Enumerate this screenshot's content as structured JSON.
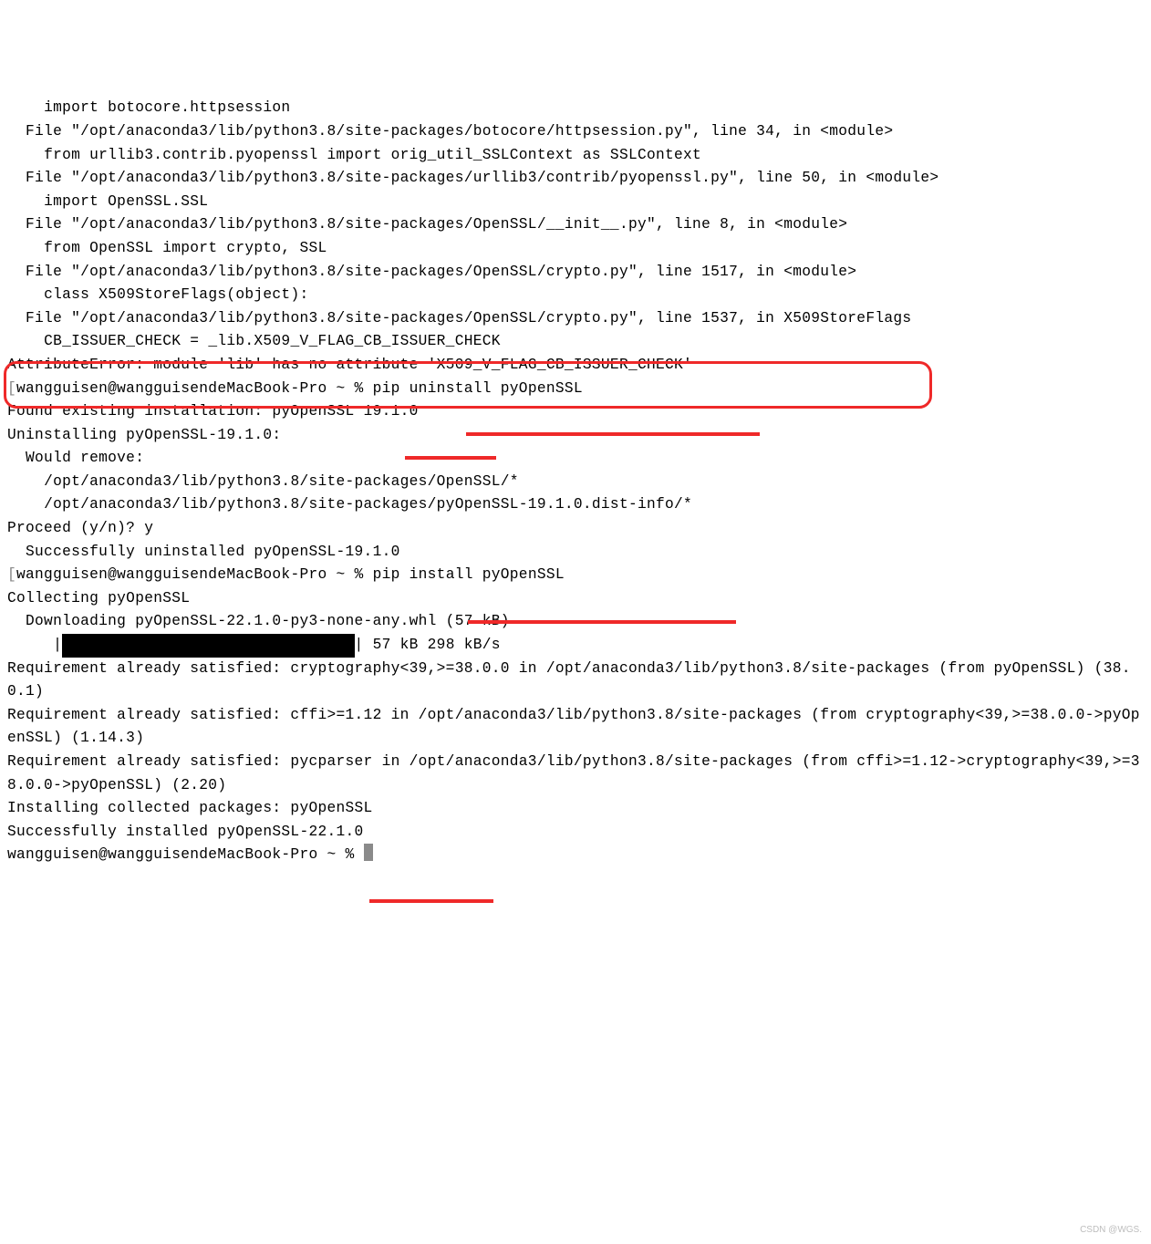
{
  "traceback": {
    "line1": "    import botocore.httpsession",
    "line2": "  File \"/opt/anaconda3/lib/python3.8/site-packages/botocore/httpsession.py\", line 34, in <module>",
    "line3": "    from urllib3.contrib.pyopenssl import orig_util_SSLContext as SSLContext",
    "line4": "  File \"/opt/anaconda3/lib/python3.8/site-packages/urllib3/contrib/pyopenssl.py\", line 50, in <module>",
    "line5": "    import OpenSSL.SSL",
    "line6": "  File \"/opt/anaconda3/lib/python3.8/site-packages/OpenSSL/__init__.py\", line 8, in <module>",
    "line7": "    from OpenSSL import crypto, SSL",
    "line8": "  File \"/opt/anaconda3/lib/python3.8/site-packages/OpenSSL/crypto.py\", line 1517, in <module>",
    "line9": "    class X509StoreFlags(object):",
    "line10": "  File \"/opt/anaconda3/lib/python3.8/site-packages/OpenSSL/crypto.py\", line 1537, in X509StoreFlags",
    "line11": "    CB_ISSUER_CHECK = _lib.X509_V_FLAG_CB_ISSUER_CHECK",
    "error": "AttributeError: module 'lib' has no attribute 'X509_V_FLAG_CB_ISSUER_CHECK'"
  },
  "prompt1": {
    "bracket_open": "[",
    "user_host": "wangguisen@wangguisendeMacBook-Pro ~ % ",
    "command": "pip uninstall pyOpenSSL",
    "bracket_close": "]"
  },
  "uninstall": {
    "found": "Found existing installation: pyOpenSSL 19.1.0",
    "uninstalling": "Uninstalling pyOpenSSL-19.1.0:",
    "would_remove": "  Would remove:",
    "path1": "    /opt/anaconda3/lib/python3.8/site-packages/OpenSSL/*",
    "path2": "    /opt/anaconda3/lib/python3.8/site-packages/pyOpenSSL-19.1.0.dist-info/*",
    "proceed": "Proceed (y/n)? y",
    "success": "  Successfully uninstalled pyOpenSSL-19.1.0"
  },
  "prompt2": {
    "bracket_open": "[",
    "user_host": "wangguisen@wangguisendeMacBook-Pro ~ % ",
    "command": "pip install pyOpenSSL",
    "bracket_close": "]"
  },
  "install": {
    "collecting": "Collecting pyOpenSSL",
    "downloading": "  Downloading pyOpenSSL-22.1.0-py3-none-any.whl (57 kB)",
    "progress_prefix": "     |",
    "progress_fill": "████████████████████████████████",
    "progress_suffix": "| 57 kB 298 kB/s",
    "req1": "Requirement already satisfied: cryptography<39,>=38.0.0 in /opt/anaconda3/lib/python3.8/site-packages (from pyOpenSSL) (38.0.1)",
    "req2": "Requirement already satisfied: cffi>=1.12 in /opt/anaconda3/lib/python3.8/site-packages (from cryptography<39,>=38.0.0->pyOpenSSL) (1.14.3)",
    "req3": "Requirement already satisfied: pycparser in /opt/anaconda3/lib/python3.8/site-packages (from cffi>=1.12->cryptography<39,>=38.0.0->pyOpenSSL) (2.20)",
    "installing": "Installing collected packages: pyOpenSSL",
    "success": "Successfully installed pyOpenSSL-22.1.0"
  },
  "prompt3": {
    "user_host": "wangguisen@wangguisendeMacBook-Pro ~ % "
  },
  "watermark": "CSDN @WGS."
}
